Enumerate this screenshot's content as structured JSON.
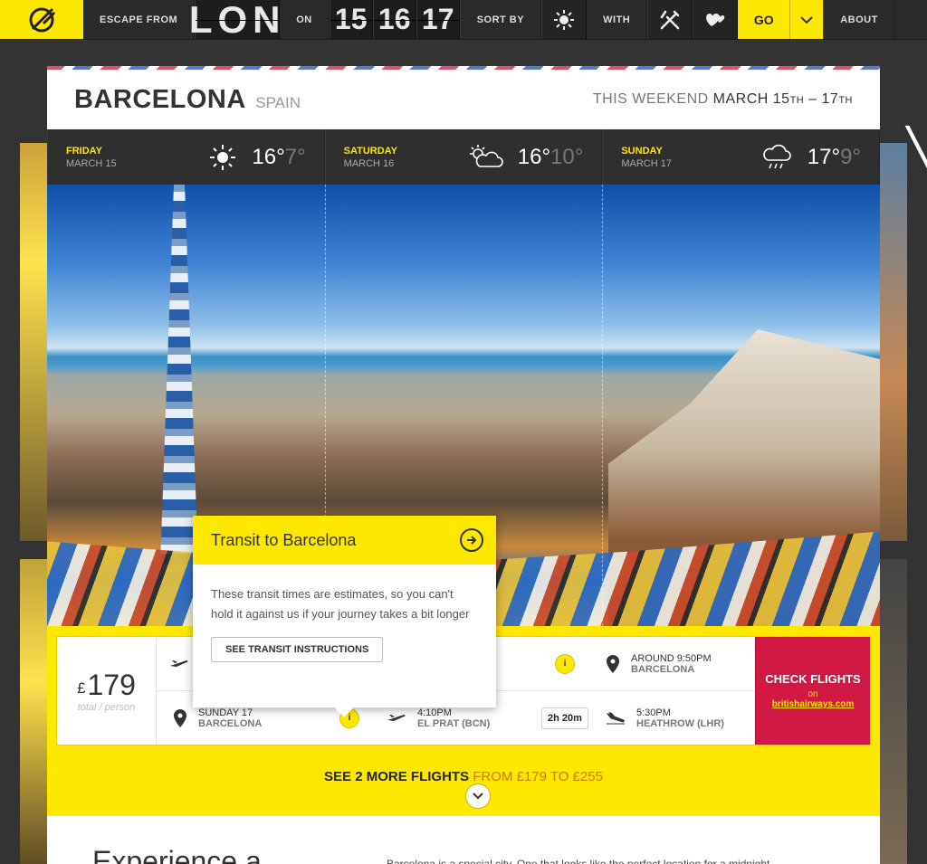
{
  "nav": {
    "escape_label": "Escape from",
    "city_code": "LON",
    "on_label": "On",
    "dates": [
      "15",
      "16",
      "17"
    ],
    "sort_label": "Sort by",
    "with_label": "With",
    "go_label": "GO",
    "about_label": "About",
    "sort_icon": "sun-icon",
    "with_icons": [
      "cutlery-icon",
      "hearts-icon"
    ]
  },
  "destination": {
    "city": "BARCELONA",
    "country": "SPAIN",
    "when_prefix": "THIS WEEKEND",
    "when_start": "MARCH 15",
    "when_start_sup": "TH",
    "when_sep": " – ",
    "when_end": "17",
    "when_end_sup": "TH"
  },
  "weather": [
    {
      "day": "FRIDAY",
      "date": "MARCH 15",
      "icon": "sun-icon",
      "high": "16°",
      "low": "7°"
    },
    {
      "day": "SATURDAY",
      "date": "MARCH 16",
      "icon": "partly-cloudy-icon",
      "high": "16°",
      "low": "10°"
    },
    {
      "day": "SUNDAY",
      "date": "MARCH 17",
      "icon": "rain-cloud-icon",
      "high": "17°",
      "low": "9°"
    }
  ],
  "flight": {
    "currency": "£",
    "price": "179",
    "price_note": "total / person",
    "outbound": {
      "arrive_time": "AROUND 9:50PM",
      "arrive_place": "BARCELONA"
    },
    "return": {
      "depart_day": "SUNDAY 17",
      "depart_place": "BARCELONA",
      "flight_time": "4:10PM",
      "flight_place": "EL PRAT (BCN)",
      "duration": "2h 20m",
      "land_time": "5:30PM",
      "land_place": "HEATHROW (LHR)"
    },
    "info_label": "i",
    "check_label": "CHECK FLIGHTS",
    "check_on": "on",
    "check_site": "britishairways.com"
  },
  "more_flights": {
    "label": "SEE 2 MORE FLIGHTS",
    "range": "FROM £179 TO £255"
  },
  "popover": {
    "title": "Transit to Barcelona",
    "text": "These transit times are estimates, so you can't hold it against us if your journey takes a bit longer",
    "button": "SEE TRANSIT INSTRUCTIONS"
  },
  "content": {
    "heading": "Experience a",
    "description": "Barcelona is a special city. One that looks like the perfect location for a midnight"
  },
  "colors": {
    "accent_yellow": "#ffe800",
    "check_red": "#d21844",
    "nav_dark": "#2a2a2a"
  }
}
